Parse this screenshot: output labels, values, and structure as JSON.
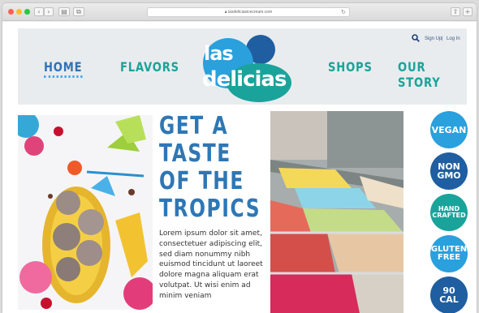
{
  "browser": {
    "url": "lasdeliciasicecream.com"
  },
  "header": {
    "nav": [
      "HOME",
      "FLAVORS",
      "SHOPS",
      "OUR STORY"
    ],
    "sign_up": "Sign Up",
    "separator": "|",
    "log_in": "Log In",
    "logo_top": "las",
    "logo_bottom": "delicias"
  },
  "hero": {
    "heading": [
      "GET A",
      "TASTE",
      "OF THE",
      "TROPICS"
    ],
    "body": "Lorem ipsum dolor sit amet, consectetuer adipiscing elit, sed diam nonummy nibh euismod tincidunt ut laoreet dolore magna aliquam erat volutpat. Ut wisi enim ad minim veniam"
  },
  "badges": [
    {
      "lines": [
        "VEGAN"
      ],
      "color": "#2aa0dd"
    },
    {
      "lines": [
        "NON",
        "GMO"
      ],
      "color": "#1f5ea0"
    },
    {
      "lines": [
        "HAND",
        "CRAFTED"
      ],
      "color": "#1aa39b"
    },
    {
      "lines": [
        "GLUTEN",
        "FREE"
      ],
      "color": "#2aa0dd"
    },
    {
      "lines": [
        "90",
        "CAL"
      ],
      "color": "#1f5ea0"
    }
  ],
  "colors": {
    "nav_active": "#2f74b8",
    "nav_inactive": "#1aa39b",
    "heading": "#2e77b5"
  }
}
